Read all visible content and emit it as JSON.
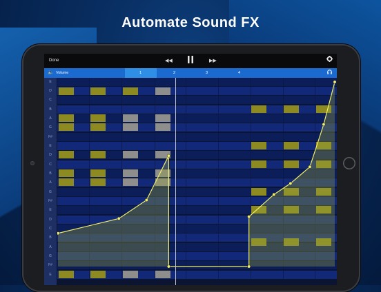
{
  "headline": "Automate Sound FX",
  "toolbar": {
    "done_label": "Done",
    "rewind_icon": "rewind-icon",
    "pause_icon": "pause-icon",
    "forward_icon": "fast-forward-icon",
    "settings_icon": "gear-icon"
  },
  "tabbar": {
    "track_label": "Volume",
    "bars": [
      "1",
      "2",
      "3",
      "4"
    ],
    "active_bar": "1"
  },
  "keys": [
    "E",
    "D",
    "C",
    "B",
    "A",
    "G",
    "F#",
    "E",
    "D",
    "C",
    "B",
    "A",
    "G",
    "F#",
    "E",
    "D",
    "C",
    "B",
    "A",
    "G",
    "F#",
    "E"
  ],
  "colors": {
    "tab_bar": "#1a6ad0",
    "note_yellow": "#8e8a22",
    "note_gray": "#8e8f8c",
    "automation_line": "#f2f06a"
  },
  "automation": {
    "parameter": "Volume",
    "points": [
      [
        0.0,
        0.18
      ],
      [
        0.22,
        0.26
      ],
      [
        0.32,
        0.36
      ],
      [
        0.4,
        0.6
      ],
      [
        0.4,
        0.0
      ],
      [
        0.69,
        0.0
      ],
      [
        0.69,
        0.27
      ],
      [
        0.78,
        0.39
      ],
      [
        0.84,
        0.45
      ],
      [
        0.91,
        0.54
      ],
      [
        0.96,
        0.77
      ],
      [
        1.0,
        1.0
      ]
    ]
  }
}
